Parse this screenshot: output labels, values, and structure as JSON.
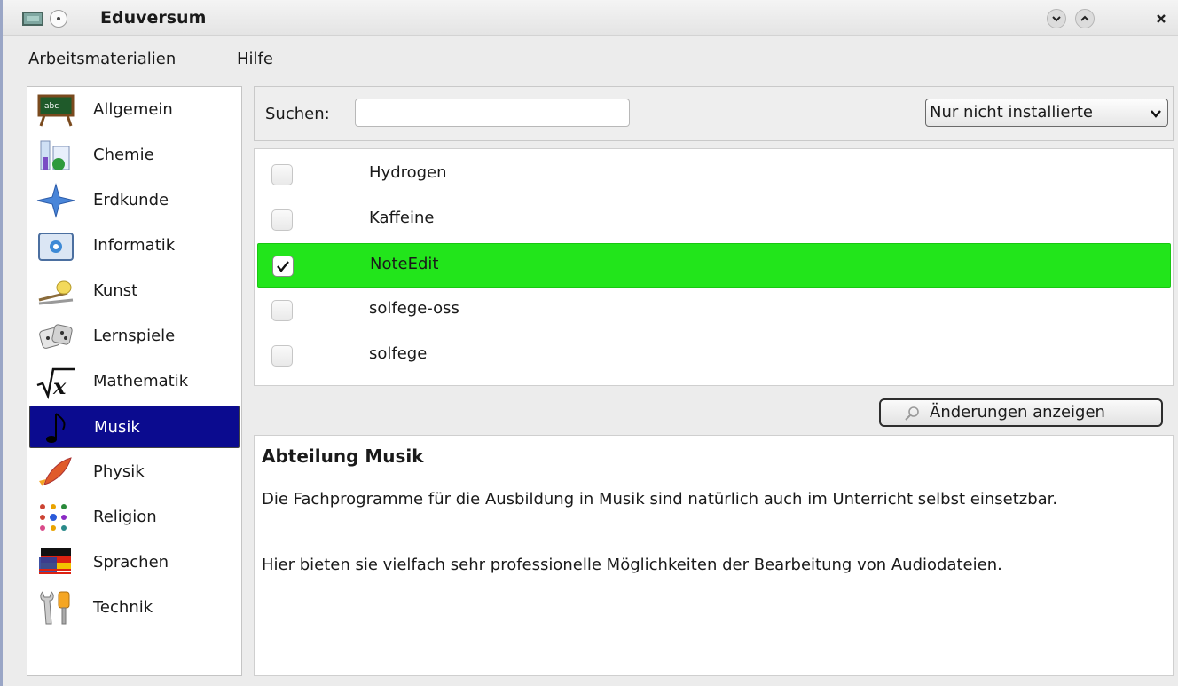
{
  "window": {
    "title": "Eduversum"
  },
  "menubar": {
    "items": [
      "Arbeitsmaterialien",
      "Hilfe"
    ]
  },
  "sidebar": {
    "selected": "Musik",
    "items": [
      {
        "label": "Allgemein",
        "icon": "chalkboard-icon"
      },
      {
        "label": "Chemie",
        "icon": "lab-flask-icon"
      },
      {
        "label": "Erdkunde",
        "icon": "compass-star-icon"
      },
      {
        "label": "Informatik",
        "icon": "computer-window-icon"
      },
      {
        "label": "Kunst",
        "icon": "paint-brush-icon"
      },
      {
        "label": "Lernspiele",
        "icon": "dice-icon"
      },
      {
        "label": "Mathematik",
        "icon": "square-root-icon"
      },
      {
        "label": "Musik",
        "icon": "music-note-icon"
      },
      {
        "label": "Physik",
        "icon": "rocket-icon"
      },
      {
        "label": "Religion",
        "icon": "religious-symbols-icon"
      },
      {
        "label": "Sprachen",
        "icon": "flags-icon"
      },
      {
        "label": "Technik",
        "icon": "wrench-screwdriver-icon"
      }
    ]
  },
  "search": {
    "label": "Suchen:",
    "value": "",
    "placeholder": ""
  },
  "filter": {
    "selected": "Nur nicht installierte"
  },
  "packages": [
    {
      "name": "Hydrogen",
      "checked": false
    },
    {
      "name": "Kaffeine",
      "checked": false
    },
    {
      "name": "NoteEdit",
      "checked": true
    },
    {
      "name": "solfege-oss",
      "checked": false
    },
    {
      "name": "solfege",
      "checked": false
    }
  ],
  "changes_button": {
    "label": "Änderungen anzeigen"
  },
  "description": {
    "title": "Abteilung Musik",
    "paragraphs": [
      "Die Fachprogramme für die Ausbildung in Musik sind natürlich auch im Unterricht selbst einsetzbar.",
      "Hier bieten sie vielfach sehr professionelle Möglichkeiten der Bearbeitung von Audiodateien."
    ]
  },
  "colors": {
    "selected_category_bg": "#0b0b8f",
    "checked_row_bg": "#22e51b",
    "window_bg": "#ececec"
  }
}
